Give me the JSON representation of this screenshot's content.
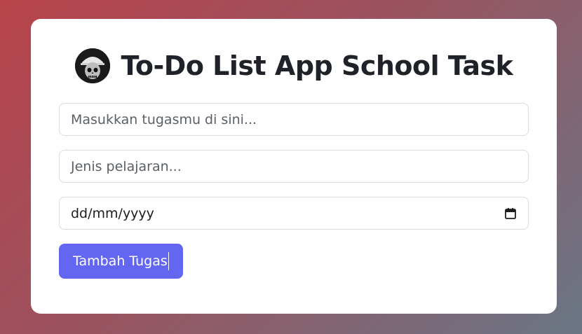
{
  "header": {
    "title": "To-Do List App School Task",
    "avatar_icon": "skull-avatar-icon"
  },
  "form": {
    "task_placeholder": "Masukkan tugasmu di sini...",
    "subject_placeholder": "Jenis pelajaran...",
    "date_placeholder": "dd/mm/yyyy",
    "date_icon": "calendar-icon",
    "submit_label": "Tambah Tugas"
  },
  "colors": {
    "accent": "#6366f1",
    "card": "#ffffff",
    "background_start": "#b8434a",
    "background_end": "#6a7685"
  }
}
